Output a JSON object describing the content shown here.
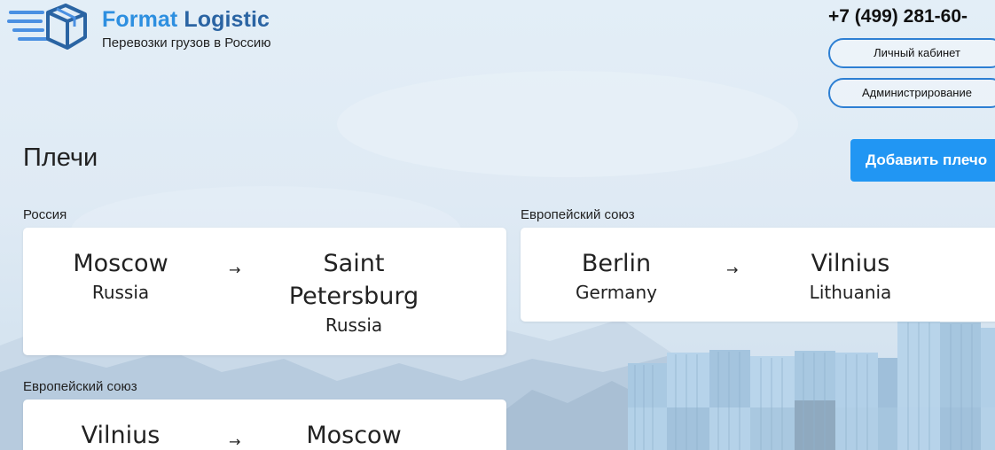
{
  "header": {
    "brand_word1": "Format",
    "brand_word2": "Logistic",
    "tagline": "Перевозки грузов в Россию",
    "phone": "+7 (499) 281-60-",
    "account_button": "Личный кабинет",
    "admin_button": "Администрирование"
  },
  "main": {
    "title": "Плечи",
    "add_button": "Добавить плечо",
    "arrow": "→",
    "routes": [
      {
        "group": "Россия",
        "from": {
          "city": "Moscow",
          "country": "Russia"
        },
        "to": {
          "city_line1": "Saint",
          "city_line2": "Petersburg",
          "country": "Russia"
        }
      },
      {
        "group": "Европейский союз",
        "from": {
          "city": "Berlin",
          "country": "Germany"
        },
        "to": {
          "city": "Vilnius",
          "country": "Lithuania"
        }
      },
      {
        "group": "Европейский союз",
        "from": {
          "city": "Vilnius"
        },
        "to": {
          "city": "Moscow"
        }
      }
    ]
  },
  "colors": {
    "brand_light": "#2d8fe0",
    "brand_dark": "#2a64a3",
    "primary_button": "#2196f3",
    "pill_border": "#2d7fd3"
  },
  "icons": [
    "logo-box-icon",
    "arrow-right-icon"
  ]
}
